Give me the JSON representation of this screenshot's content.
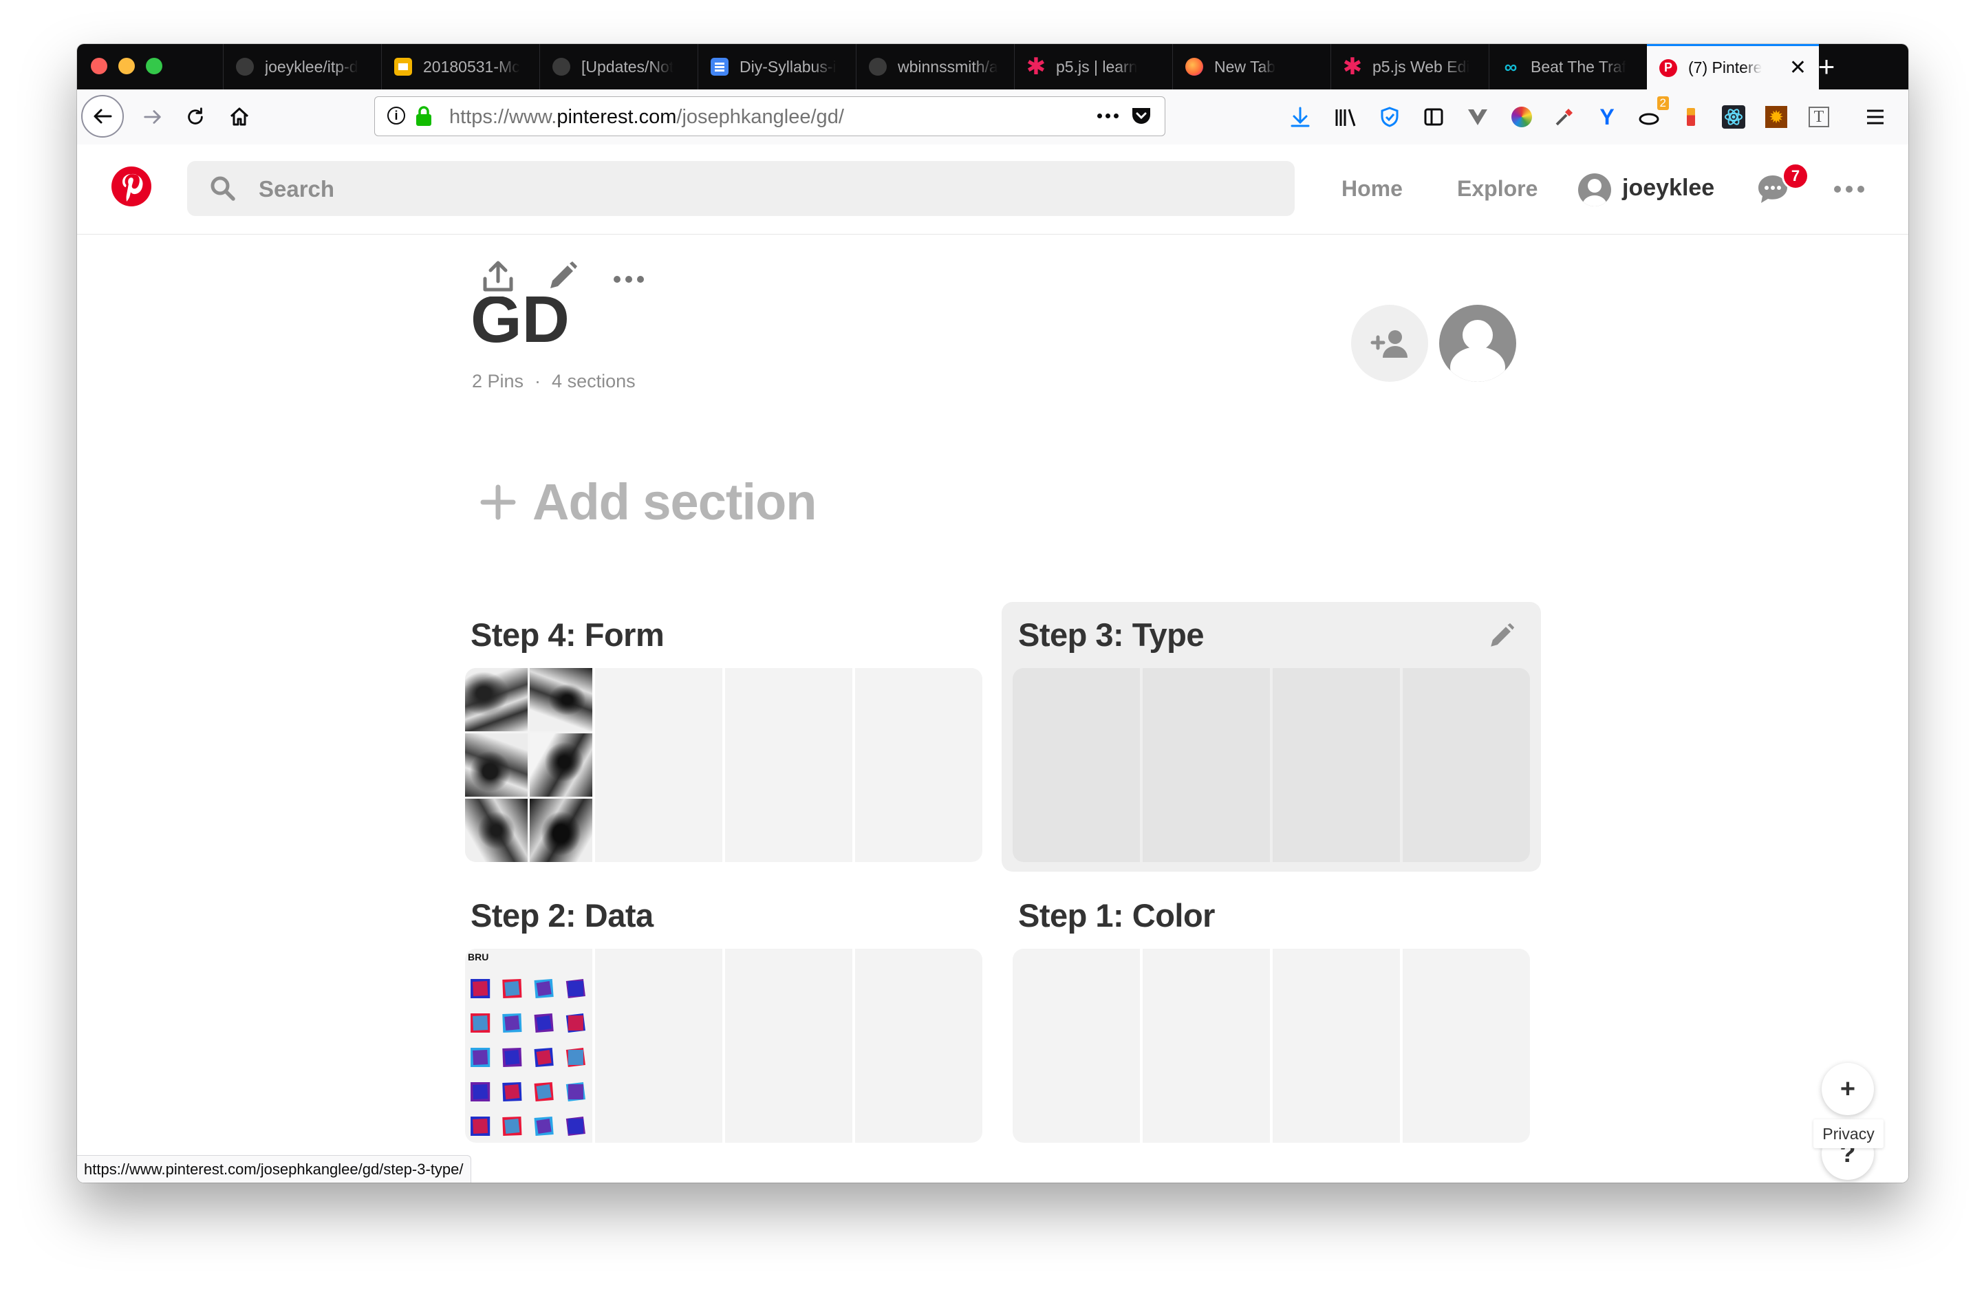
{
  "browser": {
    "tabs": [
      {
        "title": "joeyklee/itp-d",
        "icon": "github-icon",
        "color": "#24292e"
      },
      {
        "title": "20180531-Mc",
        "icon": "slides-icon",
        "color": "#f4b400"
      },
      {
        "title": "[Updates/Not",
        "icon": "github-icon",
        "color": "#24292e"
      },
      {
        "title": "Diy-Syllabus-i",
        "icon": "docs-icon",
        "color": "#4285f4"
      },
      {
        "title": "wbinnssmith/a",
        "icon": "github-icon",
        "color": "#24292e"
      },
      {
        "title": "p5.js | learn",
        "icon": "p5-icon",
        "color": "#ed225d"
      },
      {
        "title": "New Tab",
        "icon": "firefox-icon",
        "color": "#ff7139"
      },
      {
        "title": "p5.js Web Edi",
        "icon": "p5-icon",
        "color": "#ed225d"
      },
      {
        "title": "Beat The Traf",
        "icon": "link-icon",
        "color": "#12bbd4"
      },
      {
        "title": "(7) Pintere",
        "icon": "pinterest-icon",
        "color": "#e60023",
        "active": true
      }
    ],
    "url_prefix": "https://www.",
    "url_domain": "pinterest.com",
    "url_path": "/josephkanglee/gd/",
    "status_url": "https://www.pinterest.com/josephkanglee/gd/step-3-type/",
    "extension_badge": "2"
  },
  "header": {
    "search_placeholder": "Search",
    "nav_home": "Home",
    "nav_explore": "Explore",
    "username": "joeyklee",
    "notification_count": "7"
  },
  "board": {
    "title": "GD",
    "pins": "2 Pins",
    "sections_count": "4 sections",
    "add_section_label": "Add section",
    "sections": [
      {
        "title": "Step 4: Form",
        "has_thumb": "form"
      },
      {
        "title": "Step 3: Type",
        "hovered": true
      },
      {
        "title": "Step 2: Data",
        "has_thumb": "data"
      },
      {
        "title": "Step 1: Color"
      }
    ],
    "data_thumb_label": "BRU"
  },
  "footer": {
    "privacy_label": "Privacy",
    "add_button": "+",
    "help_button": "?"
  },
  "colors": {
    "brand": "#e60023",
    "tab_bar": "#0c0c0d",
    "muted_text": "#8e8e8e"
  }
}
